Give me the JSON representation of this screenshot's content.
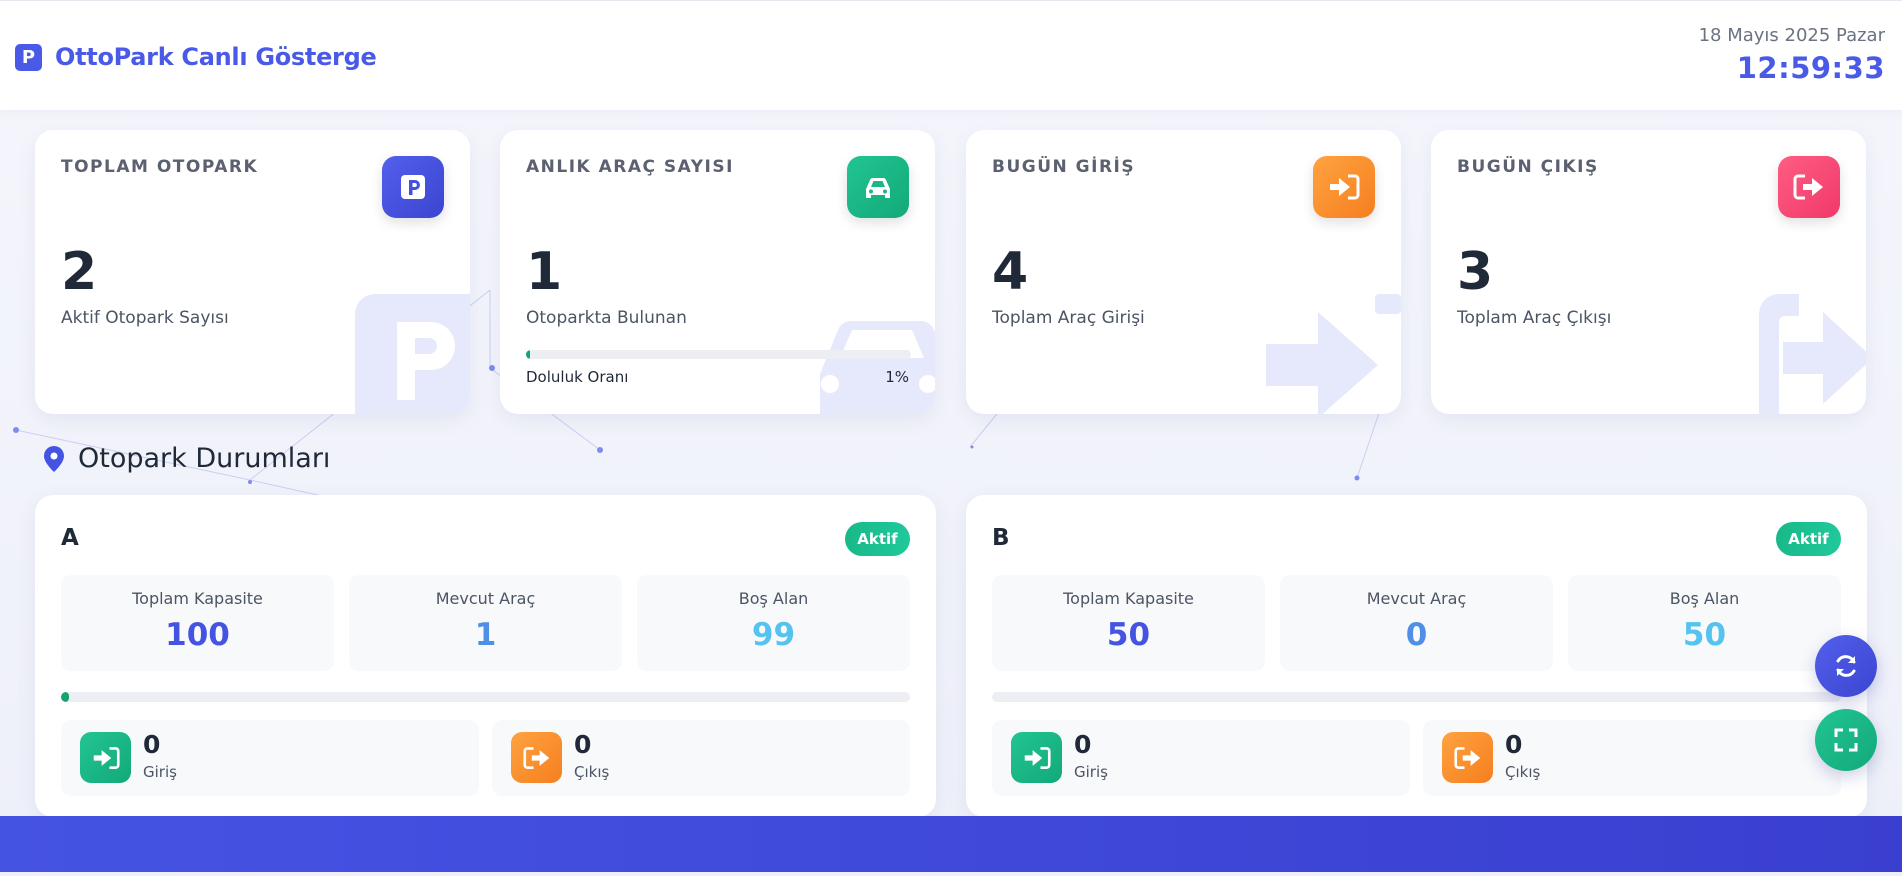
{
  "header": {
    "brand_icon": "P",
    "title": "OttoPark Canlı Gösterge",
    "date": "18 Mayıs 2025 Pazar",
    "time": "12:59:33"
  },
  "stats": [
    {
      "label": "TOPLAM OTOPARK",
      "value": "2",
      "desc": "Aktif Otopark Sayısı",
      "icon": "parking-icon",
      "color": "#4a56e2"
    },
    {
      "label": "ANLIK ARAÇ SAYISI",
      "value": "1",
      "desc": "Otoparkta Bulunan",
      "icon": "car-icon",
      "color": "#1bb787",
      "occupancy": {
        "label": "Doluluk Oranı",
        "value": "1%",
        "fraction": 0.01
      }
    },
    {
      "label": "BUGÜN GİRİŞ",
      "value": "4",
      "desc": "Toplam Araç Girişi",
      "icon": "sign-in-icon",
      "color": "#fb8f2e"
    },
    {
      "label": "BUGÜN ÇIKIŞ",
      "value": "3",
      "desc": "Toplam Araç Çıkışı",
      "icon": "sign-out-icon",
      "color": "#f5456f"
    }
  ],
  "section": {
    "title": "Otopark Durumları",
    "icon": "map-marker-icon"
  },
  "lots": [
    {
      "name": "A",
      "status": "Aktif",
      "metrics": [
        {
          "label": "Toplam Kapasite",
          "value": "100",
          "color": "#4553e3"
        },
        {
          "label": "Mevcut Araç",
          "value": "1",
          "color": "#4f8fe6"
        },
        {
          "label": "Boş Alan",
          "value": "99",
          "color": "#54c3ef"
        }
      ],
      "occupancy_fraction": 0.01,
      "entries": {
        "value": "0",
        "label": "Giriş"
      },
      "exits": {
        "value": "0",
        "label": "Çıkış"
      }
    },
    {
      "name": "B",
      "status": "Aktif",
      "metrics": [
        {
          "label": "Toplam Kapasite",
          "value": "50",
          "color": "#4553e3"
        },
        {
          "label": "Mevcut Araç",
          "value": "0",
          "color": "#4f8fe6"
        },
        {
          "label": "Boş Alan",
          "value": "50",
          "color": "#54c3ef"
        }
      ],
      "occupancy_fraction": 0,
      "entries": {
        "value": "0",
        "label": "Giriş"
      },
      "exits": {
        "value": "0",
        "label": "Çıkış"
      }
    }
  ],
  "actions": [
    {
      "icon": "refresh-icon",
      "color": "#4553e3"
    },
    {
      "icon": "fullscreen-icon",
      "color": "#1bb787"
    }
  ]
}
